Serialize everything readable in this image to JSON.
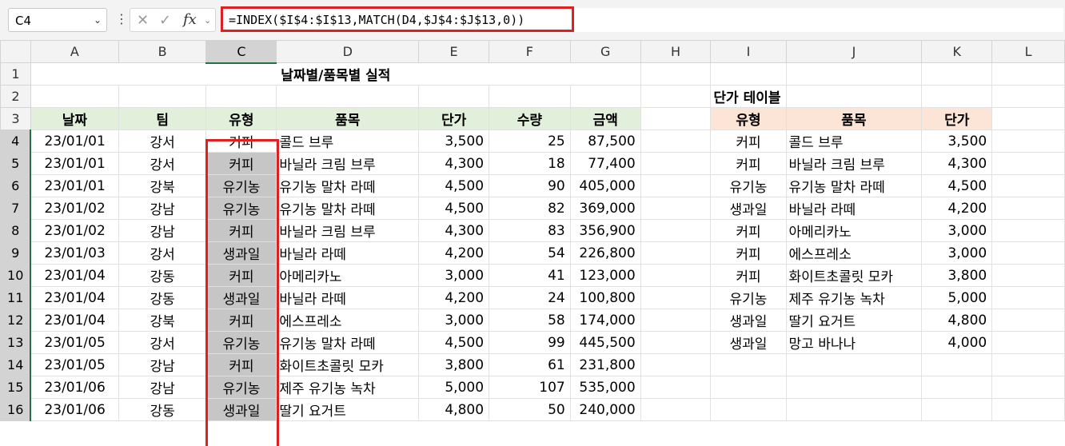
{
  "name_box": {
    "value": "C4",
    "dropdown_icon": "chevron-down-icon"
  },
  "formula_bar": {
    "icons": [
      "cancel-icon",
      "check-icon",
      "fx-icon"
    ],
    "fx_label": "fx",
    "formula": "=INDEX($I$4:$I$13,MATCH(D4,$J$4:$J$13,0))",
    "highlight_color": "#e02020"
  },
  "columns": [
    "A",
    "B",
    "C",
    "D",
    "E",
    "F",
    "G",
    "H",
    "I",
    "J",
    "K",
    "L"
  ],
  "row_numbers": [
    "1",
    "2",
    "3",
    "4",
    "5",
    "6",
    "7",
    "8",
    "9",
    "10",
    "11",
    "12",
    "13",
    "14",
    "15",
    "16"
  ],
  "selected_column": "C",
  "selected_cell": "C4",
  "sheet": {
    "title": "날짜별/품목별 실적",
    "headers": [
      "날짜",
      "팀",
      "유형",
      "품목",
      "단가",
      "수량",
      "금액"
    ],
    "rows": [
      [
        "23/01/01",
        "강서",
        "커피",
        "콜드 브루",
        "3,500",
        "25",
        "87,500"
      ],
      [
        "23/01/01",
        "강서",
        "커피",
        "바닐라 크림 브루",
        "4,300",
        "18",
        "77,400"
      ],
      [
        "23/01/01",
        "강북",
        "유기농",
        "유기농 말차 라떼",
        "4,500",
        "90",
        "405,000"
      ],
      [
        "23/01/02",
        "강남",
        "유기농",
        "유기농 말차 라떼",
        "4,500",
        "82",
        "369,000"
      ],
      [
        "23/01/02",
        "강남",
        "커피",
        "바닐라 크림 브루",
        "4,300",
        "83",
        "356,900"
      ],
      [
        "23/01/03",
        "강서",
        "생과일",
        "바닐라 라떼",
        "4,200",
        "54",
        "226,800"
      ],
      [
        "23/01/04",
        "강동",
        "커피",
        "아메리카노",
        "3,000",
        "41",
        "123,000"
      ],
      [
        "23/01/04",
        "강동",
        "생과일",
        "바닐라 라떼",
        "4,200",
        "24",
        "100,800"
      ],
      [
        "23/01/04",
        "강북",
        "커피",
        "에스프레소",
        "3,000",
        "58",
        "174,000"
      ],
      [
        "23/01/05",
        "강서",
        "유기농",
        "유기농 말차 라떼",
        "4,500",
        "99",
        "445,500"
      ],
      [
        "23/01/05",
        "강남",
        "커피",
        "화이트초콜릿 모카",
        "3,800",
        "61",
        "231,800"
      ],
      [
        "23/01/06",
        "강남",
        "유기농",
        "제주 유기농 녹차",
        "5,000",
        "107",
        "535,000"
      ],
      [
        "23/01/06",
        "강동",
        "생과일",
        "딸기 요거트",
        "4,800",
        "50",
        "240,000"
      ]
    ]
  },
  "price_table": {
    "title": "단가 테이블",
    "headers": [
      "유형",
      "품목",
      "단가"
    ],
    "rows": [
      [
        "커피",
        "콜드 브루",
        "3,500"
      ],
      [
        "커피",
        "바닐라 크림 브루",
        "4,300"
      ],
      [
        "유기농",
        "유기농 말차 라떼",
        "4,500"
      ],
      [
        "생과일",
        "바닐라 라떼",
        "4,200"
      ],
      [
        "커피",
        "아메리카노",
        "3,000"
      ],
      [
        "커피",
        "에스프레소",
        "3,000"
      ],
      [
        "커피",
        "화이트초콜릿 모카",
        "3,800"
      ],
      [
        "유기농",
        "제주 유기농 녹차",
        "5,000"
      ],
      [
        "생과일",
        "딸기 요거트",
        "4,800"
      ],
      [
        "생과일",
        "망고 바나나",
        "4,000"
      ]
    ]
  },
  "colors": {
    "main_header_fill": "#e2efda",
    "price_header_fill": "#fce4d6",
    "type_column_fill": "#c6c6c6",
    "selection_accent": "#217346"
  }
}
